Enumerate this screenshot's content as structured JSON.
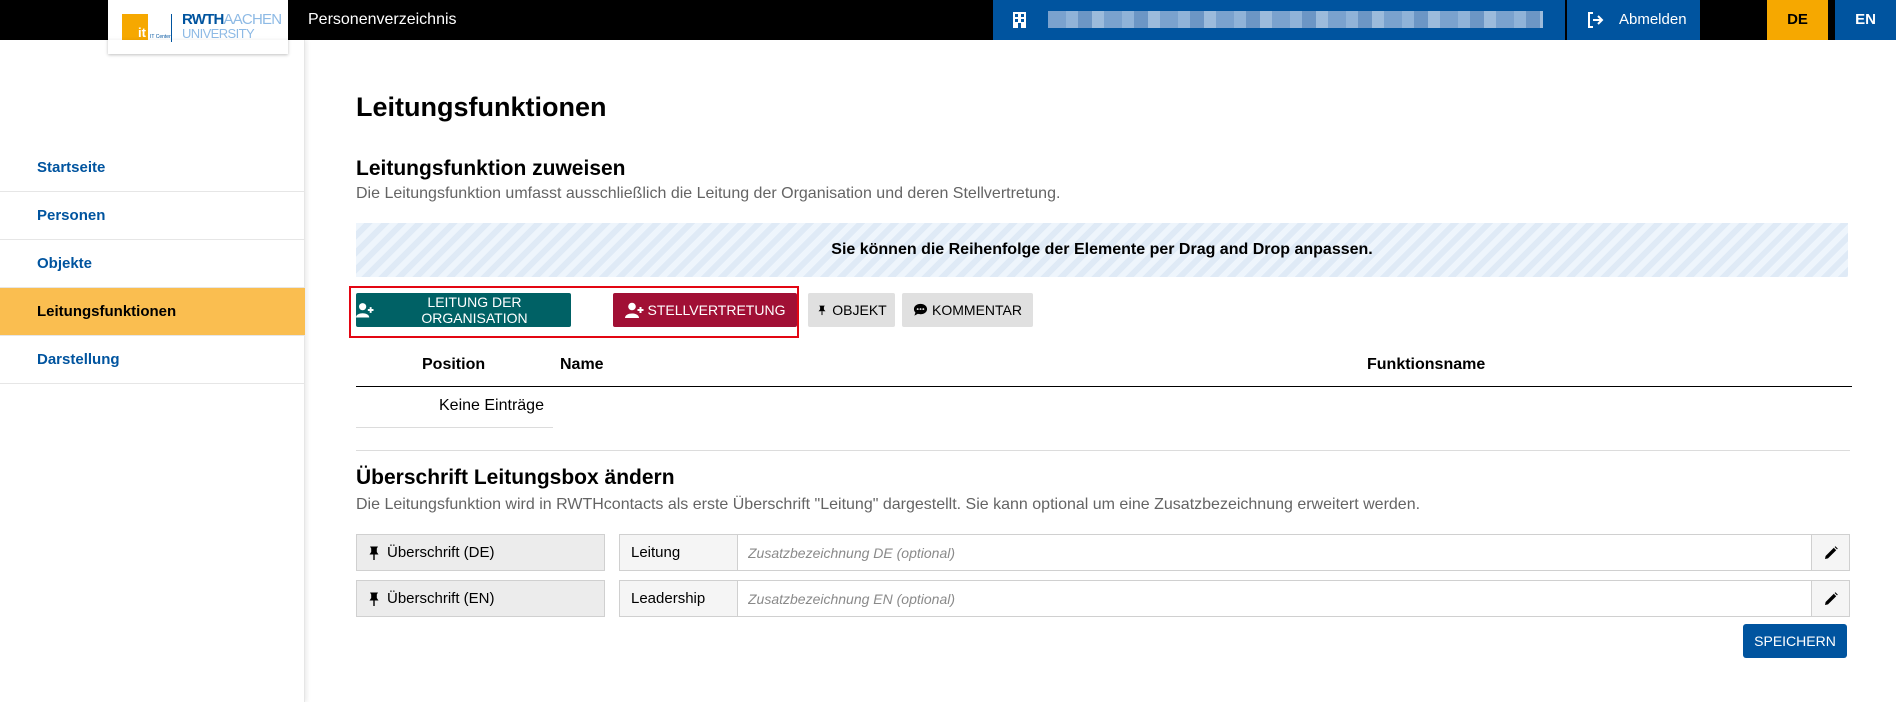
{
  "header": {
    "app_title": "Personenverzeichnis",
    "logo": {
      "it_center": "IT Center",
      "rwth": "RWTH",
      "aachen": "AACHEN",
      "university": "UNIVERSITY"
    },
    "logout_label": "Abmelden",
    "lang_de": "DE",
    "lang_en": "EN",
    "colors": {
      "bar": "#000000",
      "blue": "#00549f",
      "orange": "#f6a800"
    }
  },
  "sidebar": {
    "items": [
      {
        "label": "Startseite",
        "active": false
      },
      {
        "label": "Personen",
        "active": false
      },
      {
        "label": "Objekte",
        "active": false
      },
      {
        "label": "Leitungsfunktionen",
        "active": true
      },
      {
        "label": "Darstellung",
        "active": false
      }
    ]
  },
  "main": {
    "page_title": "Leitungsfunktionen",
    "assign": {
      "title": "Leitungsfunktion zuweisen",
      "description": "Die Leitungsfunktion umfasst ausschließlich die Leitung der Organisation und deren Stellvertretung.",
      "banner": "Sie können die Reihenfolge der Elemente per Drag and Drop anpassen.",
      "buttons": {
        "leitung": "LEITUNG DER ORGANISATION",
        "stellvertretung": "STELLVERTRETUNG",
        "objekt": "OBJEKT",
        "kommentar": "KOMMENTAR"
      },
      "table": {
        "columns": [
          "Position",
          "Name",
          "Funktionsname"
        ],
        "empty_text": "Keine Einträge"
      }
    },
    "heading_box": {
      "title": "Überschrift Leitungsbox ändern",
      "description": "Die Leitungsfunktion wird in RWTHcontacts als erste Überschrift \"Leitung\" dargestellt. Sie kann optional um eine Zusatzbezeichnung erweitert werden.",
      "rows": [
        {
          "label": "Überschrift (DE)",
          "prefix": "Leitung",
          "placeholder": "Zusatzbezeichnung DE (optional)",
          "value": ""
        },
        {
          "label": "Überschrift (EN)",
          "prefix": "Leadership",
          "placeholder": "Zusatzbezeichnung EN (optional)",
          "value": ""
        }
      ],
      "save_label": "SPEICHERN"
    }
  }
}
